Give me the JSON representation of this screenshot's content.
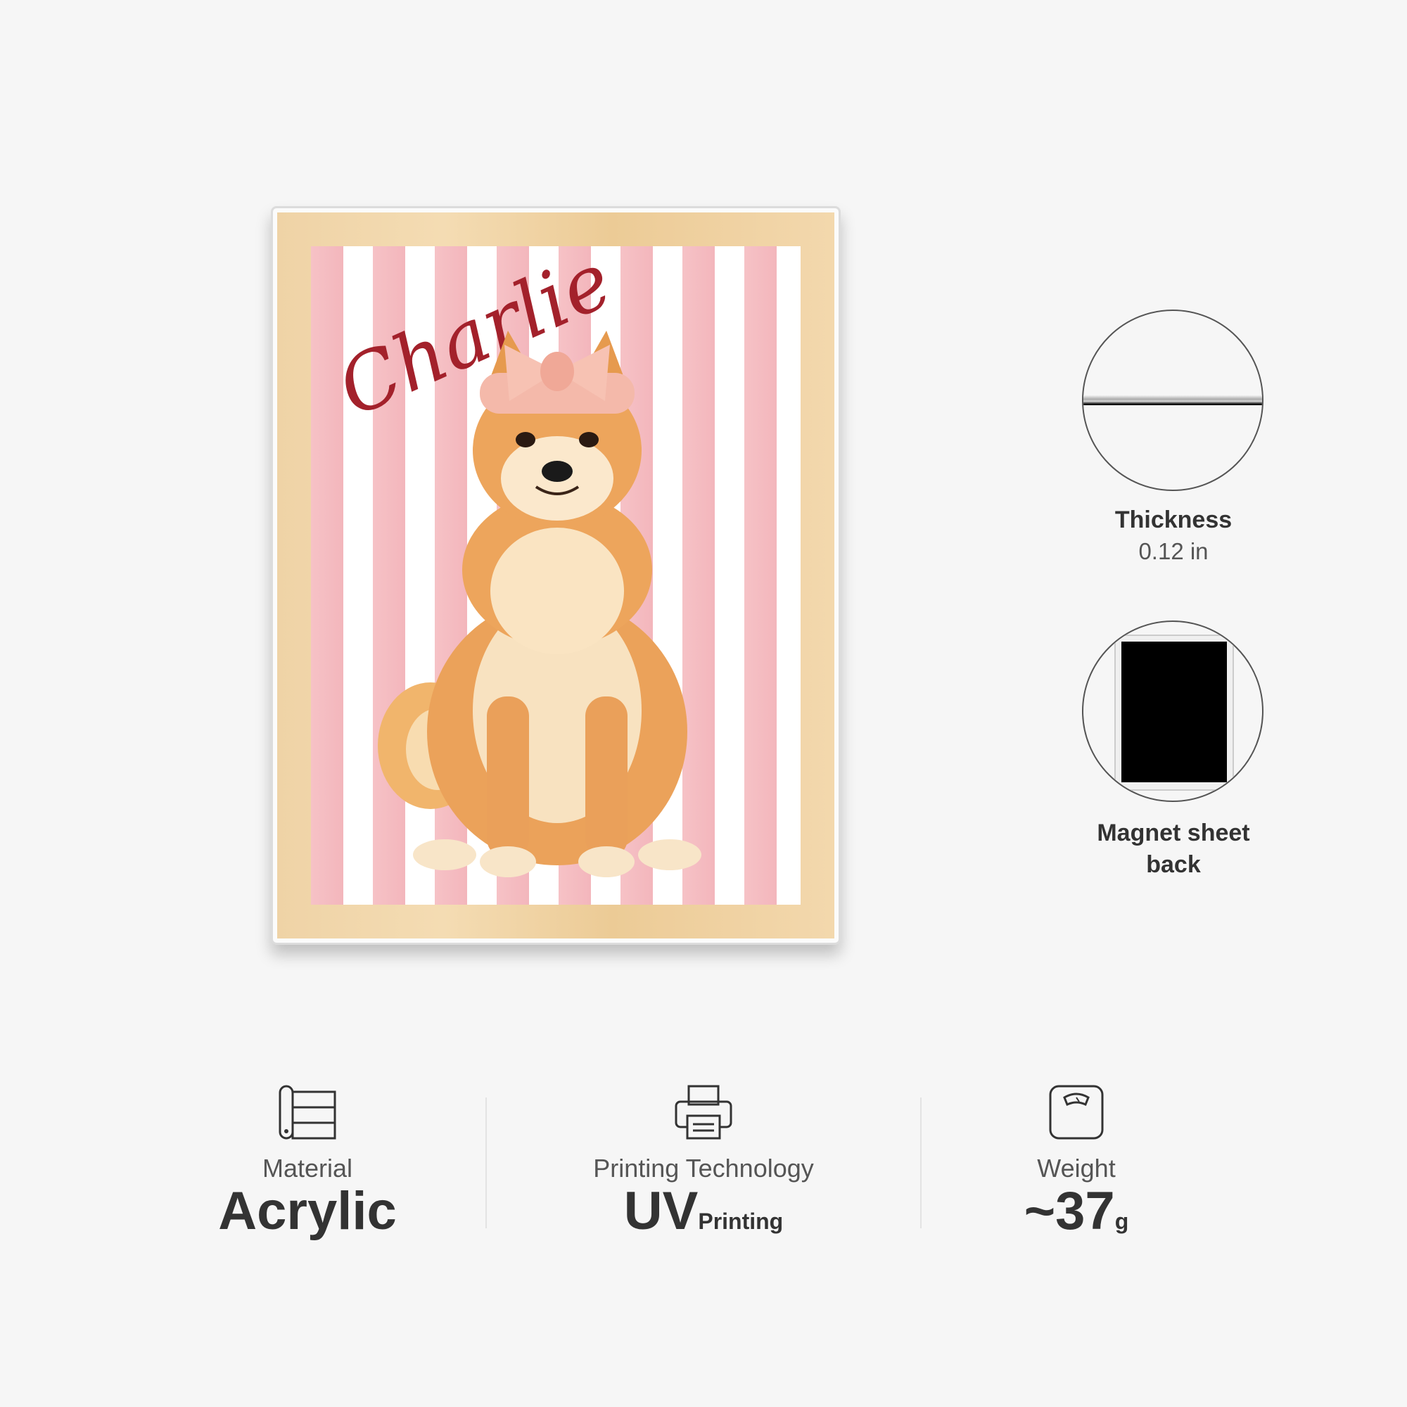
{
  "product": {
    "name_text": "Charlie"
  },
  "specs": {
    "thickness": {
      "title": "Thickness",
      "value": "0.12 in"
    },
    "magnet": {
      "title_line1": "Magnet sheet",
      "title_line2": "back"
    }
  },
  "features": [
    {
      "icon": "material-roll-icon",
      "label": "Material",
      "value": "Acrylic",
      "sub": ""
    },
    {
      "icon": "printer-icon",
      "label": "Printing Technology",
      "value": "UV",
      "sub": "Printing"
    },
    {
      "icon": "scale-icon",
      "label": "Weight",
      "value": "~37",
      "sub": "g"
    }
  ],
  "colors": {
    "background": "#f6f6f6",
    "stripe_pink": "#f6c2c6",
    "name_red": "#a3212b",
    "text_dark": "#333333"
  }
}
